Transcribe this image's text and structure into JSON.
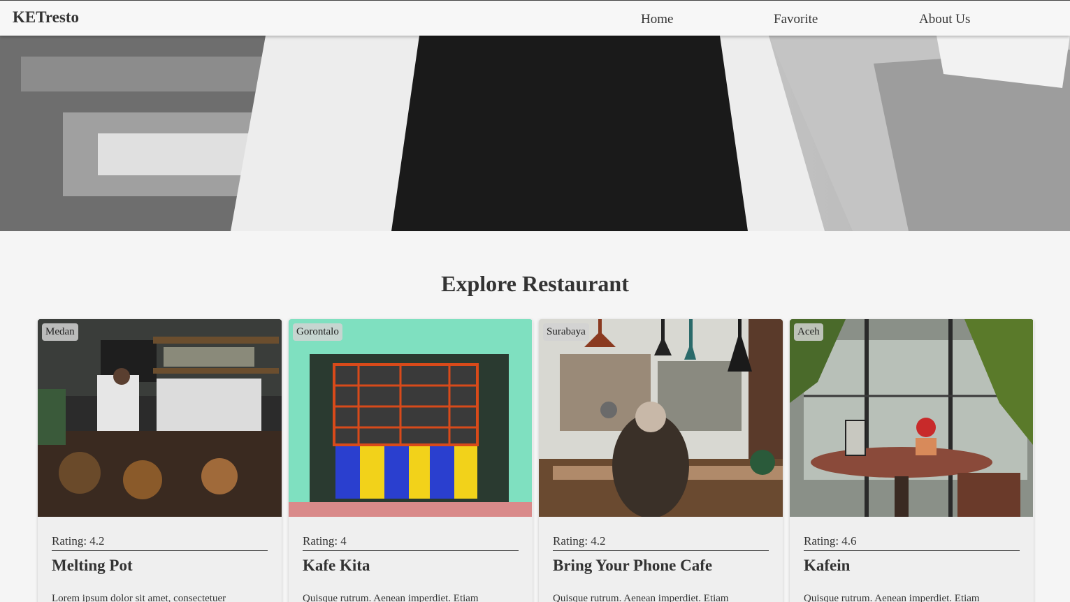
{
  "navbar": {
    "brand": "KETresto",
    "links": [
      "Home",
      "Favorite",
      "About Us"
    ]
  },
  "main": {
    "title": "Explore Restaurant"
  },
  "restaurants": [
    {
      "city": "Medan",
      "rating": "Rating: 4.2",
      "name": "Melting Pot",
      "description": "Lorem ipsum dolor sit amet, consectetuer"
    },
    {
      "city": "Gorontalo",
      "rating": "Rating: 4",
      "name": "Kafe Kita",
      "description": "Quisque rutrum. Aenean imperdiet. Etiam"
    },
    {
      "city": "Surabaya",
      "rating": "Rating: 4.2",
      "name": "Bring Your Phone Cafe",
      "description": "Quisque rutrum. Aenean imperdiet. Etiam"
    },
    {
      "city": "Aceh",
      "rating": "Rating: 4.6",
      "name": "Kafein",
      "description": "Quisque rutrum. Aenean imperdiet. Etiam"
    }
  ]
}
